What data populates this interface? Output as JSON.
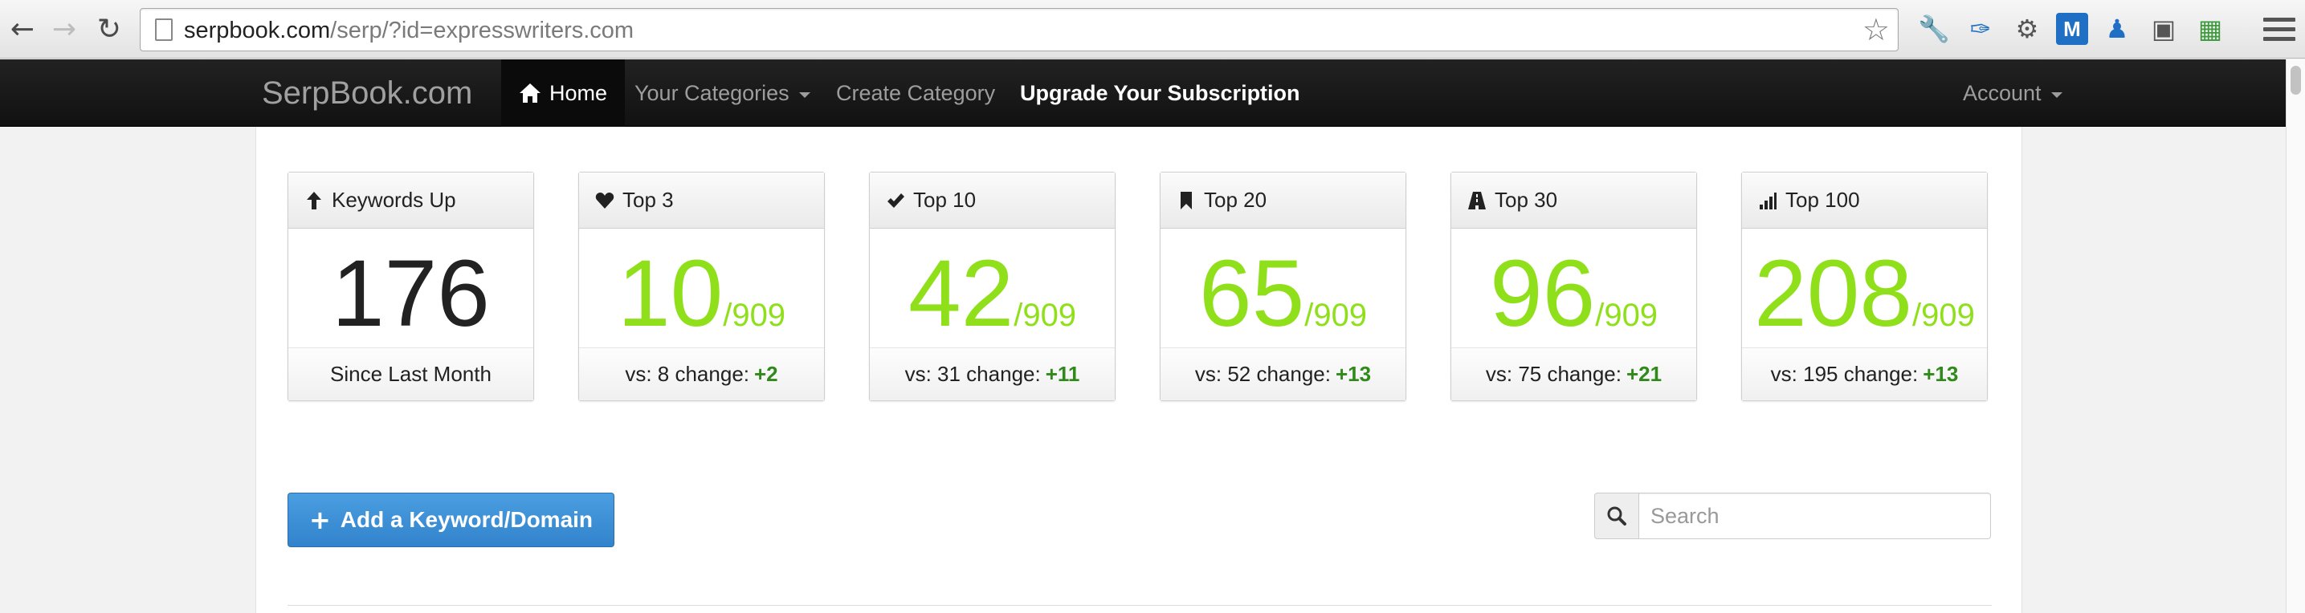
{
  "browser": {
    "url_host": "serpbook.com",
    "url_path": "/serp/?id=expresswriters.com",
    "icons": {
      "back": "back-arrow-icon",
      "forward": "forward-arrow-icon",
      "reload": "reload-icon",
      "bookmark": "star-icon"
    }
  },
  "navbar": {
    "brand": "SerpBook.com",
    "home": "Home",
    "categories": "Your Categories",
    "create": "Create Category",
    "upgrade": "Upgrade Your Subscription",
    "account": "Account"
  },
  "stats": [
    {
      "id": "keywords-up",
      "title": "Keywords Up",
      "icon": "arrow-up-icon",
      "value": "176",
      "denominator": "",
      "footer": "Since Last Month"
    },
    {
      "id": "top-3",
      "title": "Top 3",
      "icon": "heart-icon",
      "value": "10",
      "denominator": "/909",
      "vs_label": "vs: 8 change:",
      "change": "+2"
    },
    {
      "id": "top-10",
      "title": "Top 10",
      "icon": "checkmark-icon",
      "value": "42",
      "denominator": "/909",
      "vs_label": "vs: 31 change:",
      "change": "+11"
    },
    {
      "id": "top-20",
      "title": "Top 20",
      "icon": "bookmark-icon",
      "value": "65",
      "denominator": "/909",
      "vs_label": "vs: 52 change:",
      "change": "+13"
    },
    {
      "id": "top-30",
      "title": "Top 30",
      "icon": "road-icon",
      "value": "96",
      "denominator": "/909",
      "vs_label": "vs: 75 change:",
      "change": "+21"
    },
    {
      "id": "top-100",
      "title": "Top 100",
      "icon": "signal-bars-icon",
      "value": "208",
      "denominator": "/909",
      "vs_label": "vs: 195 change:",
      "change": "+13"
    }
  ],
  "actions": {
    "add_label": "Add a Keyword/Domain",
    "search_placeholder": "Search"
  },
  "colors": {
    "accent_green": "#8fe01a",
    "change_green": "#2f8a1a",
    "button_blue": "#3a8fd6",
    "navbar_bg": "#1a1a1a"
  }
}
